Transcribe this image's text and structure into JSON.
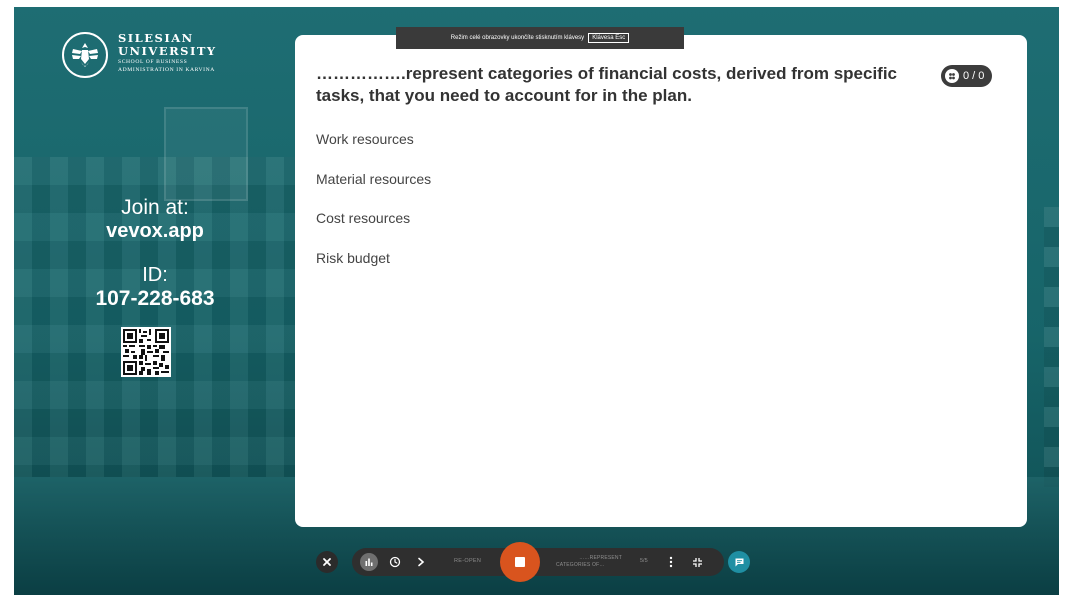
{
  "logo": {
    "line1": "SILESIAN",
    "line2": "UNIVERSITY",
    "line3": "SCHOOL OF BUSINESS",
    "line4": "ADMINISTRATION IN KARVINA"
  },
  "join": {
    "label": "Join at:",
    "url": "vevox.app",
    "id_label": "ID:",
    "id": "107-228-683"
  },
  "esc_hint": {
    "text": "Režim celé obrazovky ukončíte stisknutím klávesy",
    "key": "Klávesa Esc"
  },
  "question": {
    "text": "…………….represent categories of financial costs, derived from specific tasks, that you need to account for in the plan.",
    "counter": "0 / 0",
    "options": [
      "Work resources",
      "Material resources",
      "Cost resources",
      "Risk budget"
    ]
  },
  "toolbar": {
    "reopen_label": "RE-OPEN",
    "slide_line1": "……REPRESENT",
    "slide_line2": "CATEGORIES OF…",
    "slide_count": "5/5"
  },
  "colors": {
    "background_teal": "#15686e",
    "stop_orange": "#d9541e",
    "chat_teal": "#1f8fa3",
    "toolbar_dark": "#2f2f2f"
  }
}
